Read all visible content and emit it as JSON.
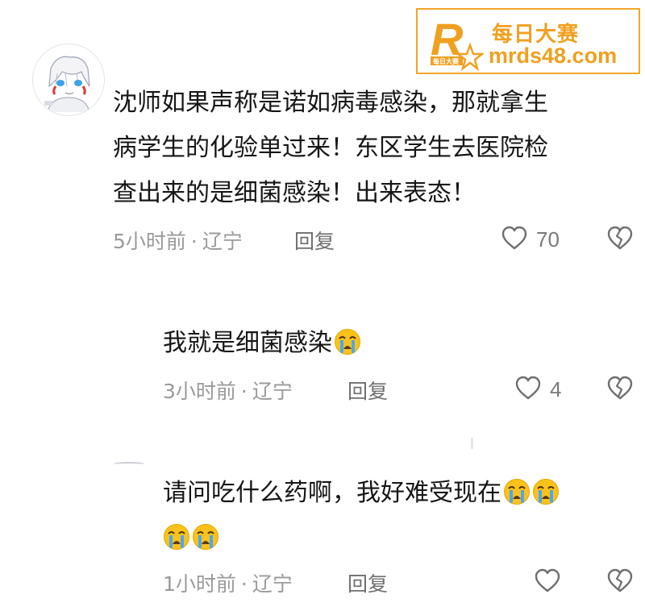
{
  "watermark": {
    "logo_letter": "R",
    "logo_small_text": "每日大赛",
    "name": "每日大赛",
    "url": "mrds48.com"
  },
  "comments": [
    {
      "text_lines": [
        "沈师如果声称是诺如病毒感染，那就拿生",
        "病学生的化验单过来！东区学生去医院检",
        "查出来的是细菌感染！出来表态！"
      ],
      "time": "5小时前",
      "separator": "·",
      "location": "辽宁",
      "reply_label": "回复",
      "like_count": "70"
    },
    {
      "text_lines": [
        "我就是细菌感染"
      ],
      "emoji_count": 1,
      "time": "3小时前",
      "separator": "·",
      "location": "辽宁",
      "reply_label": "回复",
      "like_count": "4"
    },
    {
      "text_lines": [
        "请问吃什么药啊，我好难受现在"
      ],
      "emoji_count": 4,
      "time": "1小时前",
      "separator": "·",
      "location": "辽宁",
      "reply_label": "回复",
      "like_count": ""
    }
  ],
  "icons": {
    "like": "heart-outline-icon",
    "dislike": "broken-heart-icon",
    "emoji": "loudly-crying-face-emoji"
  },
  "colors": {
    "watermark_accent": "#f0a020",
    "text": "#161616",
    "meta": "#9a9a9a",
    "icon": "#6f6f6f"
  }
}
